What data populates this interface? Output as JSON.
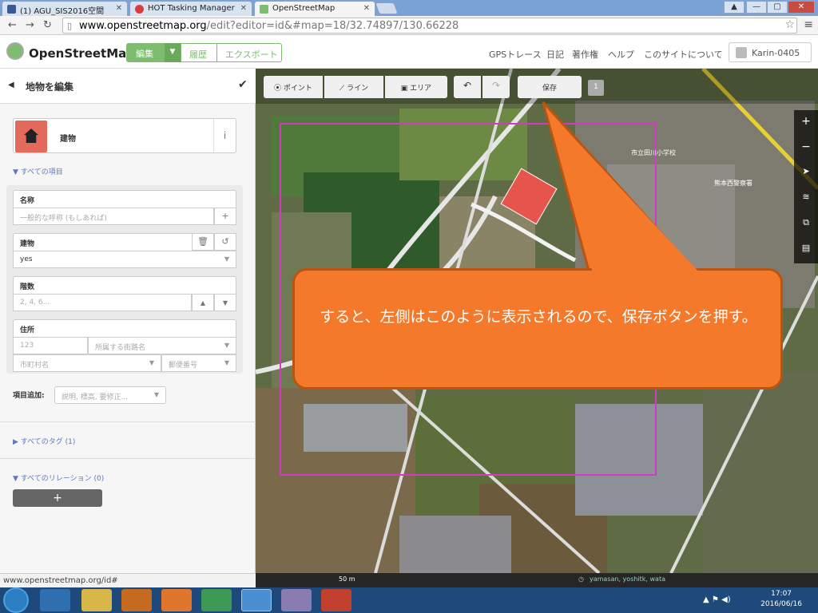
{
  "browser": {
    "tabs": [
      {
        "title": "(1) AGU_SIS2016空間"
      },
      {
        "title": "HOT Tasking Manager"
      },
      {
        "title": "OpenStreetMap"
      }
    ],
    "url_host": "www.openstreetmap.org",
    "url_path": "/edit?editor=id&#map=18/32.74897/130.66228"
  },
  "header": {
    "logo": "OpenStreetMap",
    "edit": "編集",
    "history": "履歴",
    "export": "エクスポート",
    "nav": [
      "GPSトレース",
      "日記",
      "著作権",
      "ヘルプ",
      "このサイトについて"
    ],
    "user": "Karin-0405"
  },
  "sidebar": {
    "title": "地物を編集",
    "preset_name": "建物",
    "all_fields": "▼ すべての項目",
    "fields": {
      "name_label": "名称",
      "name_placeholder": "一般的な呼称 (もしあれば)",
      "building_label": "建物",
      "building_value": "yes",
      "levels_label": "階数",
      "levels_placeholder": "2, 4, 6...",
      "address_label": "住所",
      "housenumber_placeholder": "123",
      "street_placeholder": "所属する街路名",
      "city_placeholder": "市町村名",
      "postcode_placeholder": "郵便番号"
    },
    "add_field_label": "項目追加:",
    "add_field_placeholder": "説明, 標高, 要修正...",
    "all_tags": "▶ すべてのタグ (1)",
    "all_relations": "▼ すべてのリレーション (0)",
    "add_relation": "+"
  },
  "toolbar": {
    "point": "ポイント",
    "line": "ライン",
    "area": "エリア",
    "save": "保存",
    "count": "1"
  },
  "map": {
    "labels": [
      "市立田川小学校",
      "熊本西警察署"
    ],
    "scale": "50 m",
    "attribution": "yamasan, yoshitk, wata"
  },
  "callout": {
    "text": "すると、左側はこのように表示されるので、保存ボタンを押す。"
  },
  "status": "www.openstreetmap.org/id#",
  "taskbar": {
    "time": "17:07",
    "date": "2016/06/16"
  }
}
